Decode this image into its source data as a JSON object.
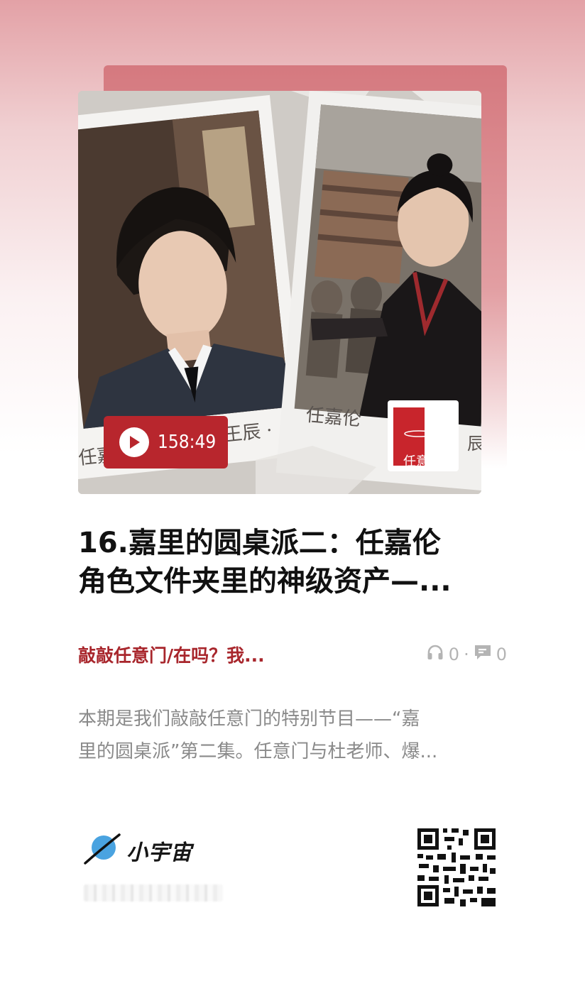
{
  "cover": {
    "duration": "158:49",
    "left_caption": "任嘉",
    "left_caption_right": "王辰 ·",
    "right_caption": "任嘉伦",
    "right_caption_end": "辰",
    "mini_cover_text": "任意门"
  },
  "episode": {
    "title_line1": "16.嘉里的圆桌派二：任嘉伦",
    "title_line2": "角色文件夹里的神级资产—..."
  },
  "meta": {
    "channel": "敲敲任意门/在吗？我...",
    "listens": "0",
    "separator": "·",
    "comments": "0"
  },
  "description": {
    "line1": "本期是我们敲敲任意门的特别节目——“嘉",
    "line2": "里的圆桌派”第二集。任意门与杜老师、爆..."
  },
  "brand": {
    "name": "小宇宙",
    "accent": "#4aa3e0"
  },
  "colors": {
    "badge": "#b8262d",
    "channel": "#a8262c",
    "card_back": "#d5797f"
  }
}
